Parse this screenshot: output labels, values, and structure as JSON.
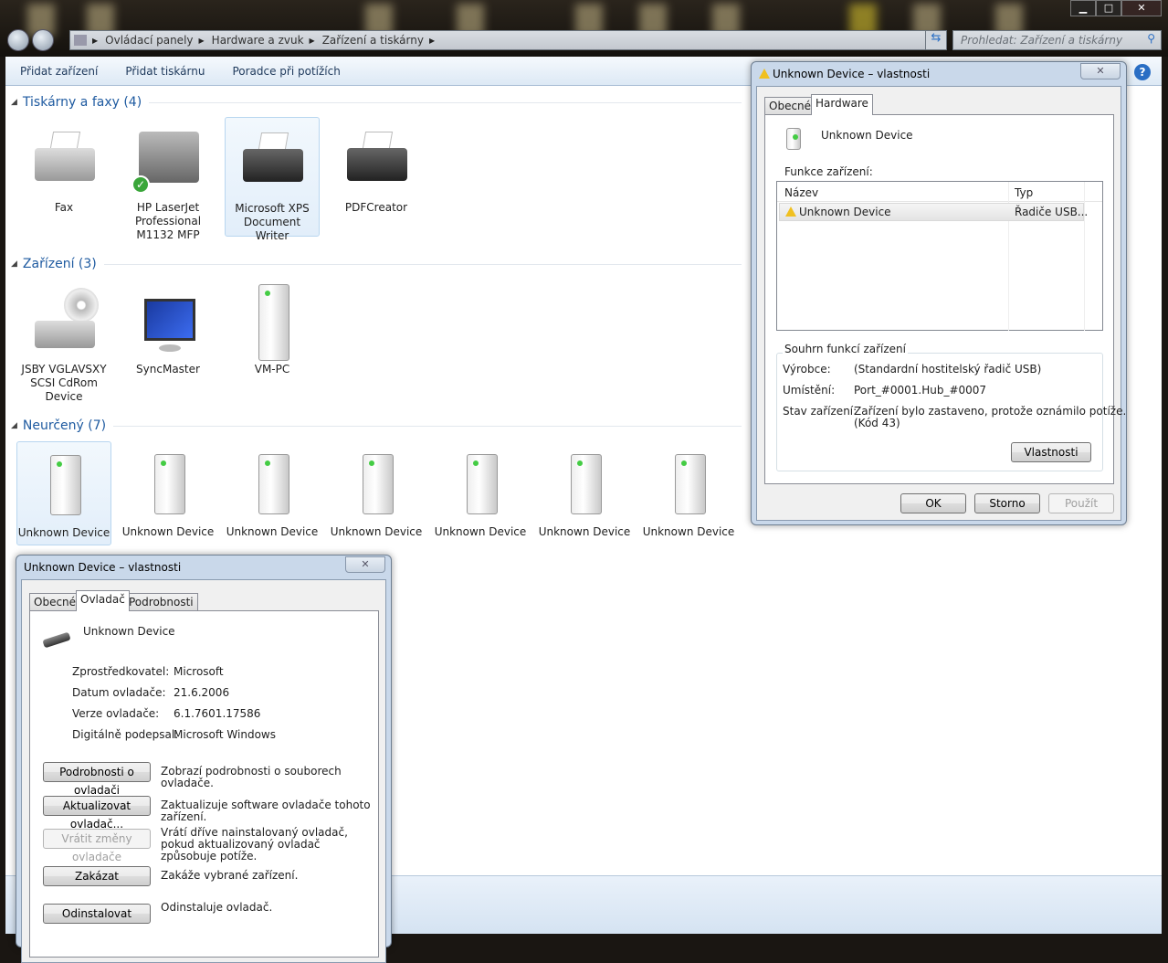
{
  "window": {
    "breadcrumb": [
      "Ovládací panely",
      "Hardware a zvuk",
      "Zařízení a tiskárny"
    ],
    "search_placeholder": "Prohledat: Zařízení a tiskárny",
    "minimize": "▁",
    "maximize": "□",
    "close": "✕"
  },
  "toolbar": {
    "items": [
      "Přidat zařízení",
      "Přidat tiskárnu",
      "Poradce při potížích"
    ],
    "help": "?"
  },
  "groups": [
    {
      "title": "Tiskárny a faxy (4)",
      "items": [
        "Fax",
        "HP LaserJet Professional M1132 MFP",
        "Microsoft XPS Document Writer",
        "PDFCreator"
      ]
    },
    {
      "title": "Zařízení (3)",
      "items": [
        "JSBY VGLAVSXY SCSI CdRom Device",
        "SyncMaster",
        "VM-PC"
      ]
    },
    {
      "title": "Neurčený (7)",
      "items": [
        "Unknown Device",
        "Unknown Device",
        "Unknown Device",
        "Unknown Device",
        "Unknown Device",
        "Unknown Device",
        "Unknown Device"
      ]
    }
  ],
  "dialog1": {
    "title": "Unknown Device – vlastnosti",
    "close": "✕",
    "tabs": [
      "Obecné",
      "Hardware"
    ],
    "device": "Unknown Device",
    "functions_label": "Funkce zařízení:",
    "columns": [
      "Název",
      "Typ"
    ],
    "rows": [
      {
        "name": "Unknown Device",
        "type": "Řadiče USB..."
      }
    ],
    "summary_label": "Souhrn funkcí zařízení",
    "manufacturer_label": "Výrobce:",
    "manufacturer": "(Standardní hostitelský řadič USB)",
    "location_label": "Umístění:",
    "location": "Port_#0001.Hub_#0007",
    "status_label": "Stav zařízení:",
    "status": "Zařízení bylo zastaveno, protože oznámilo potíže.",
    "status_code": "(Kód 43)",
    "properties_btn": "Vlastnosti",
    "ok": "OK",
    "cancel": "Storno",
    "apply": "Použít"
  },
  "dialog2": {
    "title": "Unknown Device – vlastnosti",
    "close": "✕",
    "tabs": [
      "Obecné",
      "Ovladač",
      "Podrobnosti"
    ],
    "device": "Unknown Device",
    "fields": [
      {
        "label": "Zprostředkovatel:",
        "value": "Microsoft"
      },
      {
        "label": "Datum ovladače:",
        "value": "21.6.2006"
      },
      {
        "label": "Verze ovladače:",
        "value": "6.1.7601.17586"
      },
      {
        "label": "Digitálně podepsal:",
        "value": "Microsoft Windows"
      }
    ],
    "actions": [
      {
        "button": "Podrobnosti o ovladači",
        "desc": "Zobrazí podrobnosti o souborech ovladače.",
        "disabled": false
      },
      {
        "button": "Aktualizovat ovladač...",
        "desc": "Zaktualizuje software ovladače tohoto zařízení.",
        "disabled": false
      },
      {
        "button": "Vrátit změny ovladače",
        "desc": "Vrátí dříve nainstalovaný ovladač, pokud aktualizovaný ovladač způsobuje potíže.",
        "disabled": true
      },
      {
        "button": "Zakázat",
        "desc": "Zakáže vybrané zařízení.",
        "disabled": false
      },
      {
        "button": "Odinstalovat",
        "desc": "Odinstaluje ovladač.",
        "disabled": false
      }
    ]
  }
}
